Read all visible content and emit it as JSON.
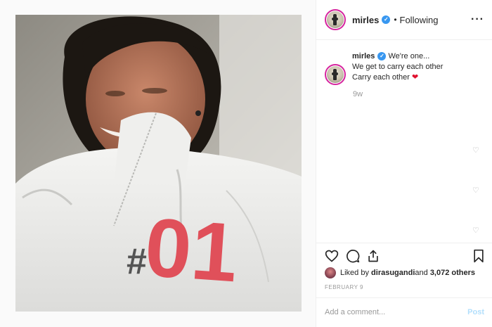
{
  "header": {
    "username": "mirles",
    "separator": "•",
    "follow_status": "Following",
    "more_label": "···"
  },
  "caption": {
    "username": "mirles",
    "line1": "We're one...",
    "line2": "We get to carry each other",
    "line3": "Carry each other",
    "emoji": "❤",
    "time": "9w"
  },
  "photo": {
    "jacket_text_hash": "#",
    "jacket_text_num": "01"
  },
  "actions": {
    "icons": [
      "heart-icon",
      "comment-icon",
      "share-icon",
      "bookmark-icon"
    ]
  },
  "likes": {
    "prefix": "Liked by ",
    "user": "dirasugandi",
    "middle": " and ",
    "count": "3,072 others"
  },
  "date": "FEBRUARY 9",
  "comment_box": {
    "placeholder": "Add a comment...",
    "post_label": "Post"
  },
  "colors": {
    "verified": "#3897f0",
    "story_ring": "#d6249f",
    "heart": "#e0102e",
    "post_button": "#b2dffc",
    "jacket_red": "#e0505a"
  }
}
